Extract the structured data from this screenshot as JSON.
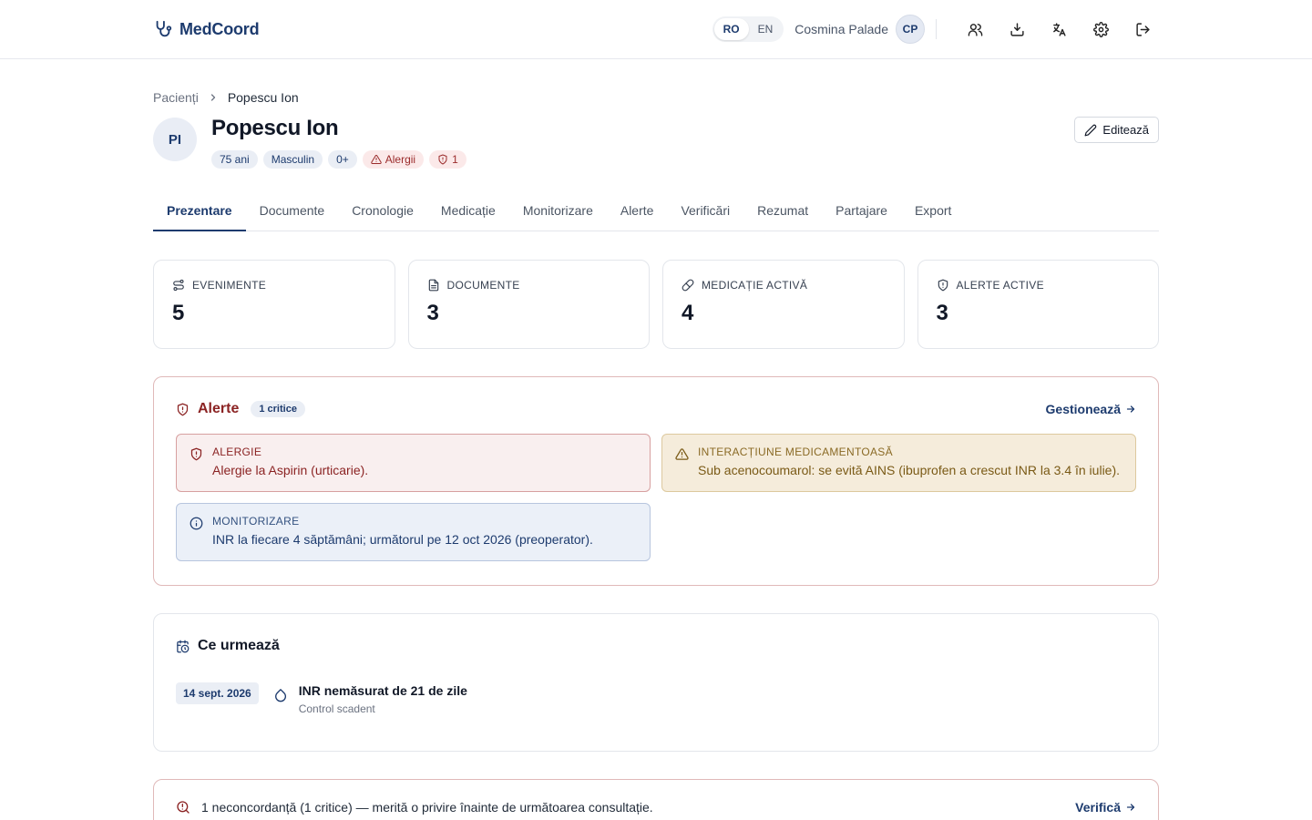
{
  "header": {
    "brand": "MedCoord",
    "lang_ro": "RO",
    "lang_en": "EN",
    "user_name": "Cosmina Palade",
    "user_initials": "CP"
  },
  "breadcrumb": {
    "parent": "Pacienți",
    "current": "Popescu Ion"
  },
  "patient": {
    "initials": "PI",
    "name": "Popescu Ion",
    "age": "75 ani",
    "sex": "Masculin",
    "blood": "0+",
    "allergy_badge": "Alergii",
    "alerts_badge": "1"
  },
  "edit_label": "Editează",
  "tabs": [
    "Prezentare",
    "Documente",
    "Cronologie",
    "Medicație",
    "Monitorizare",
    "Alerte",
    "Verificări",
    "Rezumat",
    "Partajare",
    "Export"
  ],
  "stats": [
    {
      "label": "EVENIMENTE",
      "value": "5"
    },
    {
      "label": "DOCUMENTE",
      "value": "3"
    },
    {
      "label": "MEDICAȚIE ACTIVĂ",
      "value": "4"
    },
    {
      "label": "ALERTE ACTIVE",
      "value": "3"
    }
  ],
  "alerts": {
    "title": "Alerte",
    "critical_pill": "1 critice",
    "manage_link": "Gestionează",
    "items": [
      {
        "type": "ALERGIE",
        "text": "Alergie la Aspirin (urticarie)."
      },
      {
        "type": "INTERACȚIUNE MEDICAMENTOASĂ",
        "text": "Sub acenocoumarol: se evită AINS (ibuprofen a crescut INR la 3.4 în iulie)."
      },
      {
        "type": "MONITORIZARE",
        "text": "INR la fiecare 4 săptămâni; următorul pe 12 oct 2026 (preoperator)."
      }
    ]
  },
  "next": {
    "title": "Ce urmează",
    "date": "14 sept. 2026",
    "item_title": "INR nemăsurat de 21 de zile",
    "item_sub": "Control scadent"
  },
  "discrepancy": {
    "text": "1 neconcordanță (1 critice) — merită o privire înainte de următoarea consultație.",
    "link": "Verifică"
  },
  "colors": {
    "primary": "#1d3b6e",
    "alert_red": "#8b2323",
    "alert_amber": "#7a5a16"
  }
}
